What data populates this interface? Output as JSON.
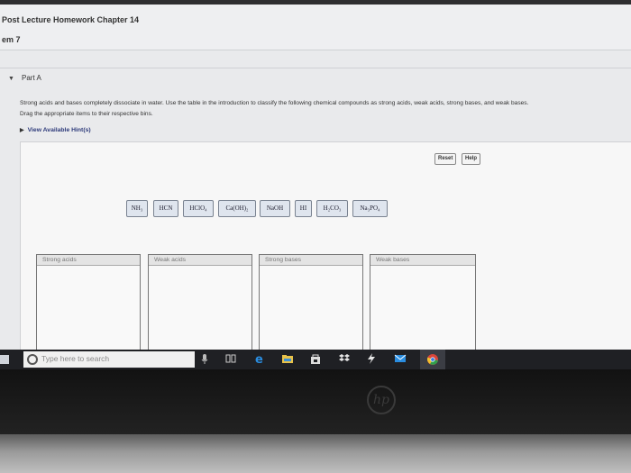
{
  "header": {
    "course_title": "Post Lecture Homework Chapter 14",
    "problem_label": "em 7"
  },
  "part": {
    "title": "Part A",
    "instruction_line1": "Strong acids and bases completely dissociate in water. Use the table in the introduction to classify the following chemical compounds as strong acids, weak acids, strong bases, and weak bases.",
    "instruction_line2": "Drag the appropriate items to their respective bins.",
    "hint_link": "View Available Hint(s)"
  },
  "controls": {
    "reset_label": "Reset",
    "help_label": "Help"
  },
  "draggables": [
    {
      "label": "NH₃"
    },
    {
      "label": "HCN"
    },
    {
      "label": "HClO₄"
    },
    {
      "label": "Ca(OH)₂"
    },
    {
      "label": "NaOH"
    },
    {
      "label": "HI"
    },
    {
      "label": "H₂CO₃"
    },
    {
      "label": "Na₃PO₄"
    }
  ],
  "bins": [
    {
      "label": "Strong acids"
    },
    {
      "label": "Weak acids"
    },
    {
      "label": "Strong bases"
    },
    {
      "label": "Weak bases"
    }
  ],
  "taskbar": {
    "search_placeholder": "Type here to search"
  },
  "laptop": {
    "logo": "hp"
  }
}
